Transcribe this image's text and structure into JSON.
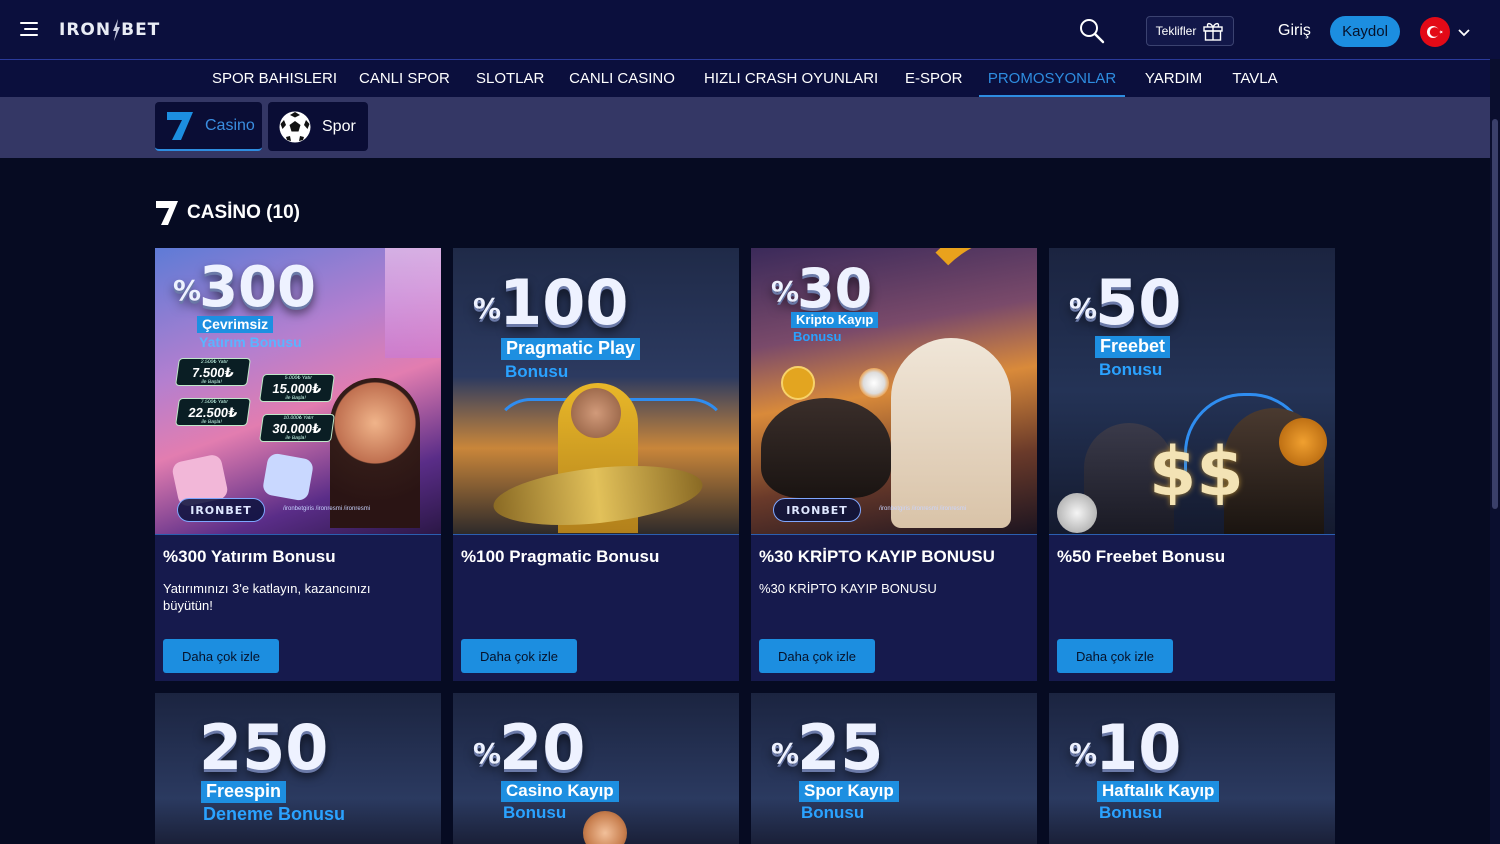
{
  "brand": {
    "logo_text_left": "IRON",
    "logo_text_right": "BET"
  },
  "header": {
    "teklifler_label": "Teklifler",
    "login_label": "Giriş",
    "register_label": "Kaydol",
    "language": "Türkçe"
  },
  "nav": {
    "items": [
      {
        "label": "SPOR BAHISLERI"
      },
      {
        "label": "CANLI SPOR"
      },
      {
        "label": "SLOTLAR"
      },
      {
        "label": "CANLI CASINO"
      },
      {
        "label": "HIZLI CRASH OYUNLARI"
      },
      {
        "label": "E-SPOR"
      },
      {
        "label": "PROMOSYONLAR"
      },
      {
        "label": "YARDIM"
      },
      {
        "label": "TAVLA"
      }
    ],
    "active": "PROMOSYONLAR"
  },
  "categories": {
    "tabs": [
      {
        "label": "Casino",
        "icon": "seven-icon",
        "active": true
      },
      {
        "label": "Spor",
        "icon": "soccer-ball-icon",
        "active": false
      }
    ]
  },
  "section": {
    "title": "CASİNO (10)"
  },
  "cards": [
    {
      "title": "%300 Yatırım Bonusu",
      "description": "Yatırımınızı 3'e katlayın, kazancınızı büyütün!",
      "button": "Daha çok izle",
      "image": {
        "pct": "%",
        "number": "300",
        "label": "Çevrimsiz",
        "sub": "Yatırım Bonusu",
        "amounts": [
          {
            "top": "2.500₺ Yatır",
            "value": "7.500₺",
            "bottom": "ile Başla!"
          },
          {
            "top": "5.000₺ Yatır",
            "value": "15.000₺",
            "bottom": "ile Başla!"
          },
          {
            "top": "7.500₺ Yatır",
            "value": "22.500₺",
            "bottom": "ile Başla!"
          },
          {
            "top": "10.000₺ Yatır",
            "value": "30.000₺",
            "bottom": "ile Başla!"
          }
        ],
        "brand": "IRONBET",
        "social": "/ironbetgiris   /ironresmi   /ironresmi"
      }
    },
    {
      "title": "%100 Pragmatic Bonusu",
      "description": "",
      "button": "Daha çok izle",
      "image": {
        "pct": "%",
        "number": "100",
        "label": "Pragmatic Play",
        "sub": "Bonusu"
      }
    },
    {
      "title": "%30 KRİPTO KAYIP BONUSU",
      "description": "%30 KRİPTO KAYIP BONUSU",
      "button": "Daha çok izle",
      "image": {
        "pct": "%",
        "number": "30",
        "label": "Kripto Kayıp",
        "sub": "Bonusu",
        "brand": "IRONBET",
        "social": "/ironbetgiris   /ironresmi   /ironresmi"
      }
    },
    {
      "title": "%50 Freebet Bonusu",
      "description": "",
      "button": "Daha çok izle",
      "image": {
        "pct": "%",
        "number": "50",
        "label": "Freebet",
        "sub": "Bonusu"
      }
    },
    {
      "image": {
        "pct": "",
        "number": "250",
        "label": "Freespin",
        "sub": "Deneme Bonusu"
      }
    },
    {
      "image": {
        "pct": "%",
        "number": "20",
        "label": "Casino Kayıp",
        "sub": "Bonusu"
      }
    },
    {
      "image": {
        "pct": "%",
        "number": "25",
        "label": "Spor Kayıp",
        "sub": "Bonusu"
      }
    },
    {
      "image": {
        "pct": "%",
        "number": "10",
        "label": "Haftalık Kayıp",
        "sub": "Bonusu"
      }
    }
  ],
  "colors": {
    "background": "#060b22",
    "header": "#0b0f3d",
    "accent": "#1c8ee0",
    "category_strip": "#343765",
    "card": "#161a4d"
  }
}
